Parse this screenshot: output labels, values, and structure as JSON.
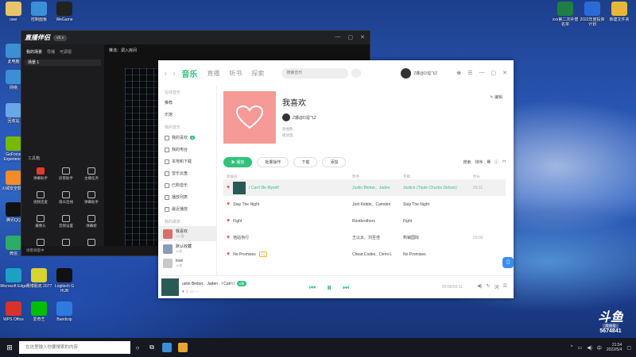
{
  "desktop": {
    "icons": [
      {
        "label": "user",
        "color": "#e9c46a"
      },
      {
        "label": "控制面板",
        "color": "#3b8fd6"
      },
      {
        "label": "WeGame",
        "color": "#222"
      },
      {
        "label": "此电脑",
        "color": "#3b8fd6"
      },
      {
        "label": "网络",
        "color": "#3b8fd6"
      },
      {
        "label": "回收站",
        "color": "#6aa7e8"
      },
      {
        "label": "GeForce Experience",
        "color": "#76b900"
      },
      {
        "label": "火绒安全软件",
        "color": "#f28c28"
      },
      {
        "label": "腾讯QQ",
        "color": "#111"
      },
      {
        "label": "微信",
        "color": "#2aae67"
      },
      {
        "label": "Microsoft Edge",
        "color": "#1ca0c4"
      },
      {
        "label": "赛博朋克 2077",
        "color": "#d9d233"
      },
      {
        "label": "Logitech G HUB",
        "color": "#111"
      },
      {
        "label": "WPS Office",
        "color": "#d8332b"
      },
      {
        "label": "爱奇艺",
        "color": "#00be06"
      },
      {
        "label": "Bandizip",
        "color": "#2d7be0"
      },
      {
        "label": "xxx第二次补偿名单",
        "color": "#1e7e45"
      },
      {
        "label": "2022年度投资计划",
        "color": "#2b6bd6"
      },
      {
        "label": "新建文件夹",
        "color": "#e8b73a"
      }
    ]
  },
  "live": {
    "logo": "直播伴侣",
    "version": "v6.x",
    "tabs": [
      "我的场景",
      "导播",
      "可调视"
    ],
    "scene": "场景 1",
    "tools_title": "工具箱",
    "tools": [
      "弹幕助手",
      "房管助手",
      "主播任务",
      "视频连麦",
      "观众连线",
      "弹幕助手",
      "摄像头",
      "音频设置",
      "弹幕姬",
      "抽奖",
      "录屏",
      "连麦"
    ],
    "top_text": "推流：调入房间",
    "status": "场景调度中"
  },
  "player": {
    "tabs": [
      "音乐",
      "直播",
      "听书",
      "探索"
    ],
    "search_placeholder": "搜索音乐",
    "user": "Z娜@D溜飞Z",
    "sidebar": {
      "groups": [
        "在线音乐",
        "我的音乐",
        "我的歌单"
      ],
      "online": [
        "推荐",
        "乐馆"
      ],
      "mine": [
        {
          "label": "我的喜欢",
          "badge": "4"
        },
        {
          "label": "我的电台",
          "badge": ""
        },
        {
          "label": "本地和下载",
          "badge": ""
        },
        {
          "label": "音乐云盘",
          "badge": ""
        },
        {
          "label": "已购音乐",
          "badge": ""
        },
        {
          "label": "播放列表",
          "badge": ""
        },
        {
          "label": "最近播放",
          "badge": ""
        }
      ],
      "playlists": [
        {
          "name": "我喜欢",
          "sub": "121首",
          "color": "#d7706a"
        },
        {
          "name": "默认收藏",
          "sub": "11首",
          "color": "#8a9bb7"
        },
        {
          "name": "love",
          "sub": "12首",
          "color": "#c9c9c9"
        }
      ]
    },
    "header": {
      "title": "我喜欢",
      "creator": "Z娜@D溜飞Z",
      "meta1": "歌曲数：",
      "meta2": "播放量：",
      "edit": "编辑"
    },
    "actions": [
      "播放",
      "批量操作",
      "下载",
      "添加"
    ],
    "actions_right": [
      "搜索",
      "排序"
    ],
    "columns": [
      "歌曲名",
      "歌手",
      "专辑",
      "时长"
    ],
    "songs": [
      {
        "title": "I Can't Be Myself",
        "singer": "Justin Bieber、Jaden",
        "album": "Justice (Triple Chucks Deluxe)",
        "duration": "03:11",
        "tag": "",
        "active": true
      },
      {
        "title": "Stay The Night",
        "singer": "Jost Kiddin、Camden",
        "album": "Stay The Night",
        "duration": "",
        "tag": "",
        "active": false
      },
      {
        "title": "Fight",
        "singer": "Rootbrothers",
        "album": "Fight",
        "duration": "",
        "tag": "",
        "active": false
      },
      {
        "title": "他站伪行",
        "singer": "王以太、刘至佳",
        "album": "热销国际",
        "duration": "03:00",
        "tag": "",
        "active": false
      },
      {
        "title": "No Promises",
        "singer": "Cheat Codes、Demi L",
        "album": "No Promises",
        "duration": "",
        "tag": "SQ",
        "active": false
      }
    ],
    "now_playing": {
      "title": "ustin Bieber、Jaden · I Can't I",
      "sing": "K歌",
      "time": "00:00/03:11"
    }
  },
  "taskbar": {
    "search_placeholder": "在这里输入你要搜索的内容",
    "time": "21:54",
    "date": "2022/5/4",
    "lang": "中"
  },
  "watermark": {
    "brand": "斗鱼",
    "sub": "房间号",
    "room": "5674841"
  }
}
